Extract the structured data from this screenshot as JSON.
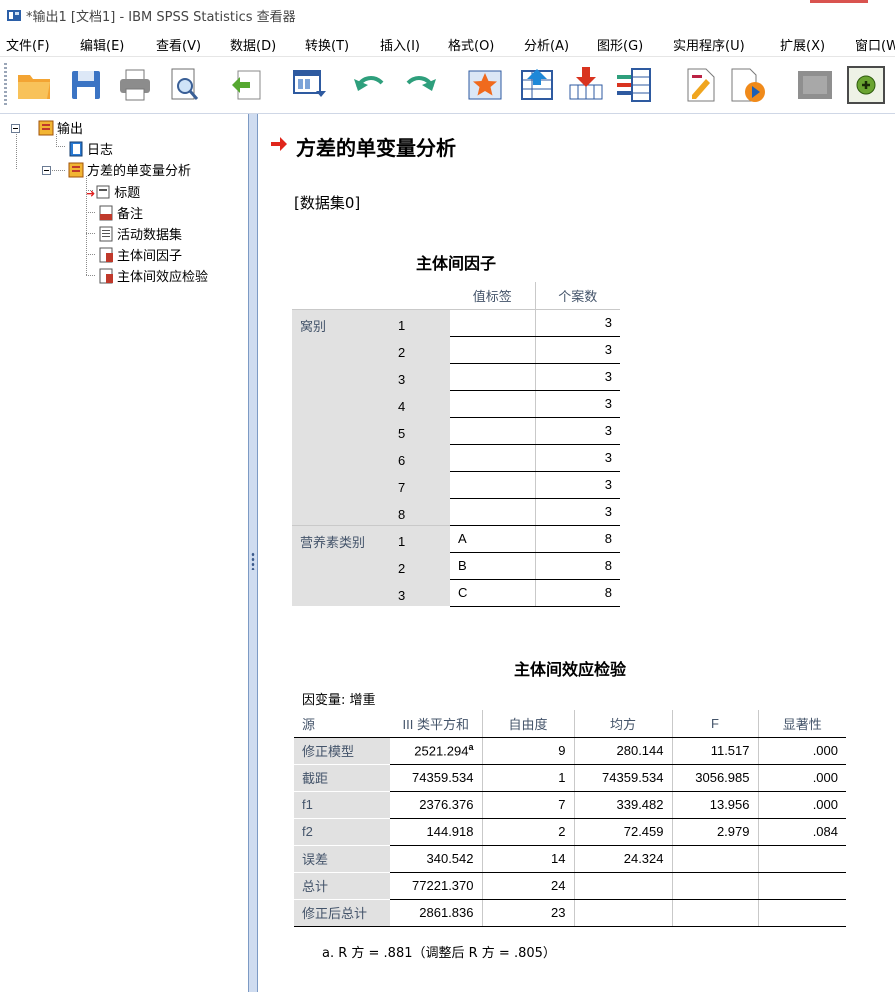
{
  "window": {
    "title": "*输出1 [文档1] - IBM SPSS Statistics 查看器"
  },
  "menu": [
    "文件(F)",
    "编辑(E)",
    "查看(V)",
    "数据(D)",
    "转换(T)",
    "插入(I)",
    "格式(O)",
    "分析(A)",
    "图形(G)",
    "实用程序(U)",
    "扩展(X)",
    "窗口(W)"
  ],
  "toolbar": {
    "icons": [
      "open-folder-icon",
      "save-icon",
      "print-icon",
      "print-preview-icon",
      "export-icon",
      "recall-dialog-icon",
      "undo-icon",
      "redo-icon",
      "goto-data-icon",
      "goto-case-icon",
      "goto-variable-icon",
      "variables-icon",
      "select-last-output-icon",
      "designate-window-icon",
      "collapse-icon",
      "show-icon"
    ],
    "accent": "#e07b1a"
  },
  "tree": {
    "root": "输出",
    "log": "日志",
    "analysis": "方差的单变量分析",
    "children": [
      "标题",
      "备注",
      "活动数据集",
      "主体间因子",
      "主体间效应检验"
    ]
  },
  "output": {
    "title": "方差的单变量分析",
    "dataset": "[数据集0]",
    "factors_table": {
      "caption": "主体间因子",
      "headers": [
        "值标签",
        "个案数"
      ],
      "groups": [
        {
          "name": "窝别",
          "rows": [
            {
              "level": "1",
              "label": "",
              "n": "3"
            },
            {
              "level": "2",
              "label": "",
              "n": "3"
            },
            {
              "level": "3",
              "label": "",
              "n": "3"
            },
            {
              "level": "4",
              "label": "",
              "n": "3"
            },
            {
              "level": "5",
              "label": "",
              "n": "3"
            },
            {
              "level": "6",
              "label": "",
              "n": "3"
            },
            {
              "level": "7",
              "label": "",
              "n": "3"
            },
            {
              "level": "8",
              "label": "",
              "n": "3"
            }
          ]
        },
        {
          "name": "营养素类别",
          "rows": [
            {
              "level": "1",
              "label": "A",
              "n": "8"
            },
            {
              "level": "2",
              "label": "B",
              "n": "8"
            },
            {
              "level": "3",
              "label": "C",
              "n": "8"
            }
          ]
        }
      ]
    },
    "effects_table": {
      "caption": "主体间效应检验",
      "dependent": "因变量:   增重",
      "headers": [
        "源",
        "III 类平方和",
        "自由度",
        "均方",
        "F",
        "显著性"
      ],
      "rows": [
        {
          "source": "修正模型",
          "ss": "2521.294",
          "sup": "a",
          "df": "9",
          "ms": "280.144",
          "f": "11.517",
          "sig": ".000"
        },
        {
          "source": "截距",
          "ss": "74359.534",
          "sup": "",
          "df": "1",
          "ms": "74359.534",
          "f": "3056.985",
          "sig": ".000"
        },
        {
          "source": "f1",
          "ss": "2376.376",
          "sup": "",
          "df": "7",
          "ms": "339.482",
          "f": "13.956",
          "sig": ".000"
        },
        {
          "source": "f2",
          "ss": "144.918",
          "sup": "",
          "df": "2",
          "ms": "72.459",
          "f": "2.979",
          "sig": ".084"
        },
        {
          "source": "误差",
          "ss": "340.542",
          "sup": "",
          "df": "14",
          "ms": "24.324",
          "f": "",
          "sig": ""
        },
        {
          "source": "总计",
          "ss": "77221.370",
          "sup": "",
          "df": "24",
          "ms": "",
          "f": "",
          "sig": ""
        },
        {
          "source": "修正后总计",
          "ss": "2861.836",
          "sup": "",
          "df": "23",
          "ms": "",
          "f": "",
          "sig": ""
        }
      ],
      "footnote": "a. R 方 = .881（调整后 R 方 = .805）"
    }
  }
}
